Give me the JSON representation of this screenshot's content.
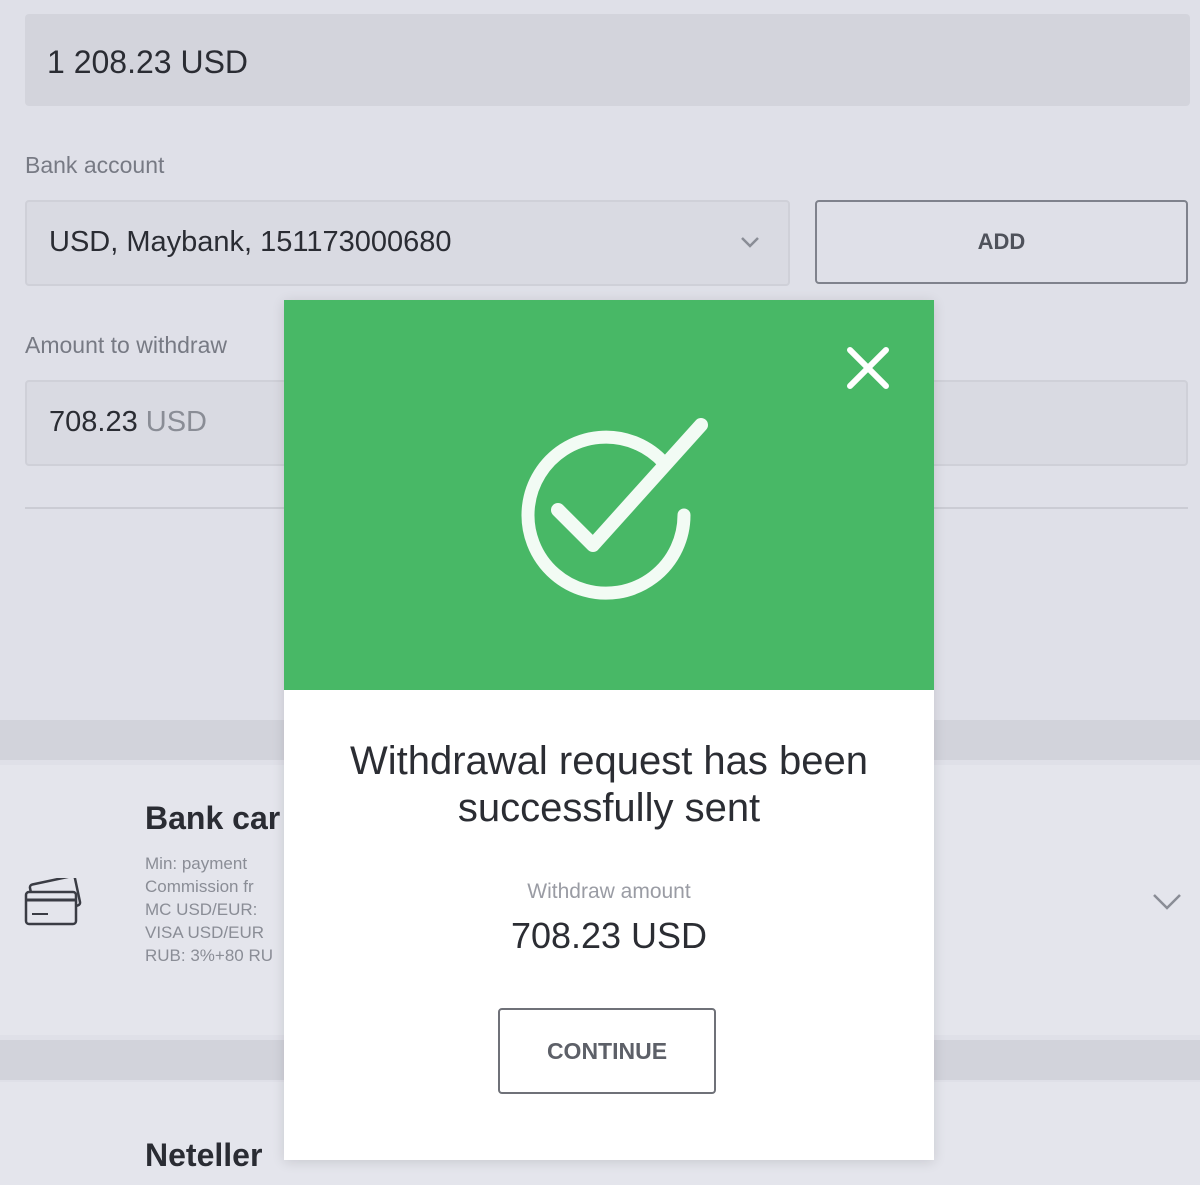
{
  "form": {
    "balance": "1 208.23 USD",
    "bank_account_label": "Bank account",
    "bank_account_value": "USD, Maybank, 151173000680",
    "add_button": "ADD",
    "amount_label": "Amount to withdraw",
    "amount_number": "708.23",
    "amount_currency": " USD"
  },
  "methods": [
    {
      "title": "Bank car",
      "details": [
        "Min: payment",
        "Commission fr",
        "MC USD/EUR:",
        "VISA USD/EUR",
        "RUB: 3%+80 RU"
      ]
    },
    {
      "title": "Neteller"
    }
  ],
  "modal": {
    "title_line1": "Withdrawal request has been",
    "title_line2": "successfully sent",
    "amount_label": "Withdraw amount",
    "amount_value": "708.23 USD",
    "continue_button": "CONTINUE"
  },
  "colors": {
    "success_green": "#48b866",
    "background": "#dfe0e8"
  },
  "icons": {
    "close": "close-icon",
    "success": "check-circle-icon",
    "card": "credit-card-icon",
    "dropdown": "chevron-down-icon"
  }
}
